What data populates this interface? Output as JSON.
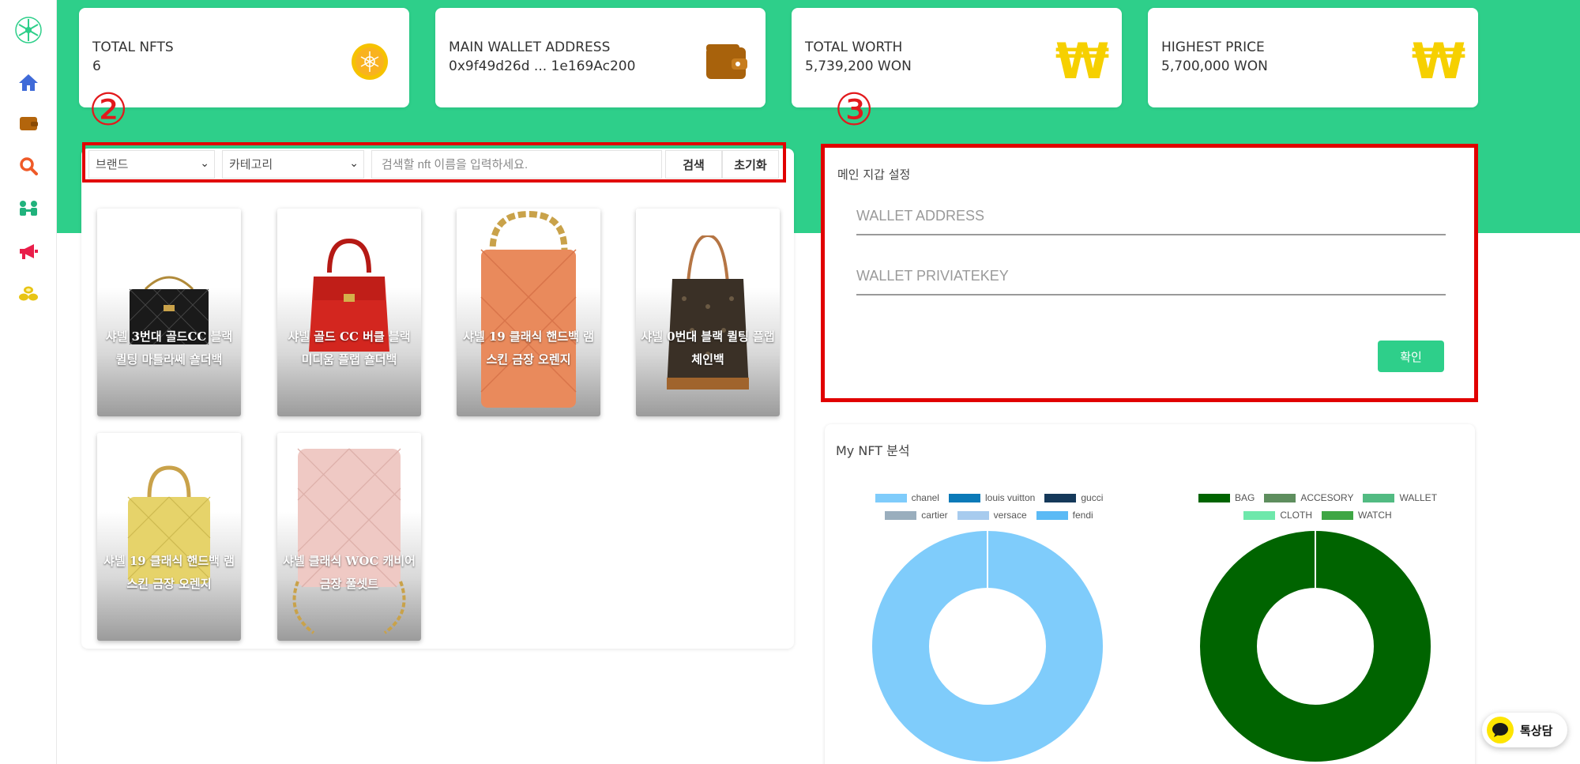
{
  "sidebar": {
    "items": [
      {
        "icon": "snowflake-logo-icon",
        "color": "#2ecf8a"
      },
      {
        "icon": "home-icon",
        "color": "#3f6ad8"
      },
      {
        "icon": "wallet-icon",
        "color": "#b3650c"
      },
      {
        "icon": "search-icon",
        "color": "#ef5a28"
      },
      {
        "icon": "users-icon",
        "color": "#20b27c"
      },
      {
        "icon": "megaphone-icon",
        "color": "#e91e4a"
      },
      {
        "icon": "coins-icon",
        "color": "#e8c414"
      }
    ]
  },
  "stats": [
    {
      "label": "TOTAL NFTS",
      "value": "6",
      "icon": "coin-icon"
    },
    {
      "label": "MAIN WALLET ADDRESS",
      "value": "0x9f49d26d ... 1e169Ac200",
      "icon": "wallet-icon"
    },
    {
      "label": "TOTAL WORTH",
      "value": "5,739,200 WON",
      "icon": "won-icon"
    },
    {
      "label": "HIGHEST PRICE",
      "value": "5,700,000 WON",
      "icon": "won-icon"
    }
  ],
  "won_symbol": "₩",
  "markers": {
    "two": "②",
    "three": "③"
  },
  "search": {
    "brand_select": "브랜드",
    "category_select": "카테고리",
    "placeholder": "검색할 nft 이름을 입력하세요.",
    "search_button": "검색",
    "reset_button": "초기화"
  },
  "nfts": [
    {
      "name": "샤넬 3번대 골드CC 블랙 퀼팅 마틀라쎄 숄더백",
      "bag_color": "#1a1a1a"
    },
    {
      "name": "샤넬 골드 CC 버클 블랙 미디움 플랩 숄더백",
      "bag_color": "#d3261f"
    },
    {
      "name": "샤넬 19 클래식 핸드백 램스킨 금장 오렌지",
      "bag_color": "#e98a5c"
    },
    {
      "name": "샤넬 0번대 블랙 퀼팅 플랩 체인백",
      "bag_color": "#3a3026"
    },
    {
      "name": "샤넬 19 클래식 핸드백 램스킨 금장 오렌지",
      "bag_color": "#e6d36a"
    },
    {
      "name": "샤넬 클래식 WOC 캐비어 금장 풀셋트",
      "bag_color": "#efc9c4"
    }
  ],
  "wallet": {
    "title": "메인 지갑 설정",
    "address_placeholder": "WALLET ADDRESS",
    "key_placeholder": "WALLET PRIVIATEKEY",
    "confirm": "확인"
  },
  "analysis": {
    "title": "My NFT 분석"
  },
  "chart_data": [
    {
      "type": "pie",
      "donut": true,
      "legend_position": "top",
      "categories": [
        "chanel",
        "louis vuitton",
        "gucci",
        "cartier",
        "versace",
        "fendi"
      ],
      "colors": [
        "#7fccfb",
        "#0b7ab8",
        "#15395a",
        "#9aaebd",
        "#a7cbee",
        "#5bbaf5"
      ],
      "values": [
        6,
        0,
        0,
        0,
        0,
        0
      ]
    },
    {
      "type": "pie",
      "donut": true,
      "legend_position": "top",
      "categories": [
        "BAG",
        "ACCESORY",
        "WALLET",
        "CLOTH",
        "WATCH"
      ],
      "colors": [
        "#006400",
        "#5e8e5e",
        "#52bb82",
        "#6ee8ab",
        "#3ea644"
      ],
      "values": [
        6,
        0,
        0,
        0,
        0
      ]
    }
  ],
  "kakao": {
    "label": "톡상담"
  }
}
